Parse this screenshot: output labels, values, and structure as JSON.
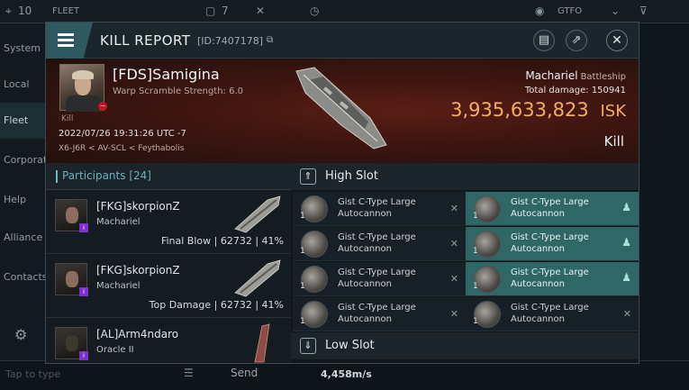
{
  "topbar": {
    "count": "10",
    "fleet": "FLEET",
    "doc_count": "7",
    "status": "GTFO"
  },
  "sidebar": {
    "items": [
      {
        "label": "System"
      },
      {
        "label": "Local"
      },
      {
        "label": "Fleet"
      },
      {
        "label": "Corporation"
      },
      {
        "label": "Help"
      },
      {
        "label": "Alliance"
      },
      {
        "label": "Contacts"
      }
    ]
  },
  "bottombar": {
    "input_placeholder": "Tap to type",
    "send_label": "Send",
    "speed": "4,458m/s"
  },
  "modal": {
    "title": "KILL REPORT",
    "id": "[ID:7407178]",
    "victim": {
      "name": "[FDS]Samigina",
      "sub": "Warp Scramble Strength: 6.0",
      "small_label": "Kill",
      "date": "2022/07/26 19:31:26 UTC -7",
      "location": "X6-J6R < AV-SCL < Feythabolis"
    },
    "ship": {
      "name": "Machariel",
      "class": "Battleship"
    },
    "total_damage_label": "Total damage:",
    "total_damage": "150941",
    "isk_value": "3,935,633,823",
    "isk_unit": "ISK",
    "result": "Kill"
  },
  "participants": {
    "label": "Participants",
    "count": "[24]",
    "rows": [
      {
        "name": "[FKG]skorpionZ",
        "ship": "Machariel",
        "tag": "Final Blow",
        "damage": "62732",
        "percent": "41%"
      },
      {
        "name": "[FKG]skorpionZ",
        "ship": "Machariel",
        "tag": "Top Damage",
        "damage": "62732",
        "percent": "41%"
      },
      {
        "name": "[AL]Arm4ndaro",
        "ship": "Oracle II",
        "tag": "",
        "damage": "",
        "percent": ""
      }
    ]
  },
  "slots": {
    "high_label": "High Slot",
    "low_label": "Low Slot",
    "high_items": [
      {
        "name": "Gist C-Type Large Autocannon",
        "qty": "1",
        "status": "destroyed"
      },
      {
        "name": "Gist C-Type Large Autocannon",
        "qty": "1",
        "status": "dropped"
      },
      {
        "name": "Gist C-Type Large Autocannon",
        "qty": "1",
        "status": "destroyed"
      },
      {
        "name": "Gist C-Type Large Autocannon",
        "qty": "1",
        "status": "dropped"
      },
      {
        "name": "Gist C-Type Large Autocannon",
        "qty": "1",
        "status": "destroyed"
      },
      {
        "name": "Gist C-Type Large Autocannon",
        "qty": "1",
        "status": "dropped"
      },
      {
        "name": "Gist C-Type Large Autocannon",
        "qty": "1",
        "status": "destroyed"
      },
      {
        "name": "Gist C-Type Large Autocannon",
        "qty": "1",
        "status": "destroyed"
      }
    ]
  },
  "colors": {
    "accent": "#2f6767",
    "isk": "#f3ae5e",
    "banner": "#3e1510"
  }
}
